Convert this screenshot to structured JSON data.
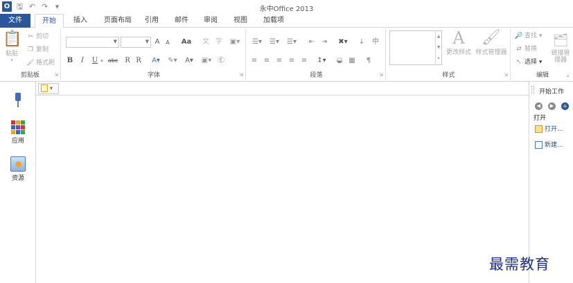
{
  "title_bar": {
    "app_logo_letter": "O",
    "title": "永中Office 2013",
    "qat_icons": [
      "save-icon",
      "undo-icon",
      "redo-icon",
      "customize-icon"
    ]
  },
  "tabs": [
    {
      "label": "文件",
      "active": false,
      "accent": "#2b579a"
    },
    {
      "label": "开始",
      "active": true
    },
    {
      "label": "插入"
    },
    {
      "label": "页面布局"
    },
    {
      "label": "引用"
    },
    {
      "label": "邮件"
    },
    {
      "label": "审阅"
    },
    {
      "label": "视图"
    },
    {
      "label": "加载项"
    }
  ],
  "ribbon": {
    "clipboard": {
      "label": "剪贴板",
      "paste": "粘贴",
      "cut": "剪切",
      "copy": "复制",
      "format_painter": "格式刷"
    },
    "font": {
      "label": "字体",
      "font_name": "",
      "font_size": "",
      "grow": "A",
      "shrink": "A",
      "change_case": "Aa",
      "bold": "B",
      "italic": "I",
      "underline": "U",
      "strike": "abc",
      "subscript": "R",
      "superscript": "R"
    },
    "paragraph": {
      "label": "段落",
      "show_marks": "¶"
    },
    "styles": {
      "label": "样式",
      "change_styles": "更改样式",
      "style_manager": "样式管理器"
    },
    "editing": {
      "label": "编辑",
      "find": "查找",
      "replace": "替换",
      "select": "选择",
      "link_manager": "链接管理器"
    }
  },
  "left_panel": {
    "items": [
      {
        "label": "",
        "icon": "pin-icon"
      },
      {
        "label": "应用",
        "icon": "apps-icon"
      },
      {
        "label": "资源",
        "icon": "resources-icon"
      }
    ]
  },
  "right_pane": {
    "title": "开始工作",
    "open_heading": "打开",
    "links": [
      {
        "label": "打开...",
        "icon": "open-folder-icon"
      },
      {
        "label": "新建...",
        "icon": "new-document-icon"
      }
    ]
  },
  "watermark": "最需教育",
  "colors": {
    "accent": "#2b579a",
    "link": "#1f4e9e",
    "watermark": "#1c2f8e"
  }
}
